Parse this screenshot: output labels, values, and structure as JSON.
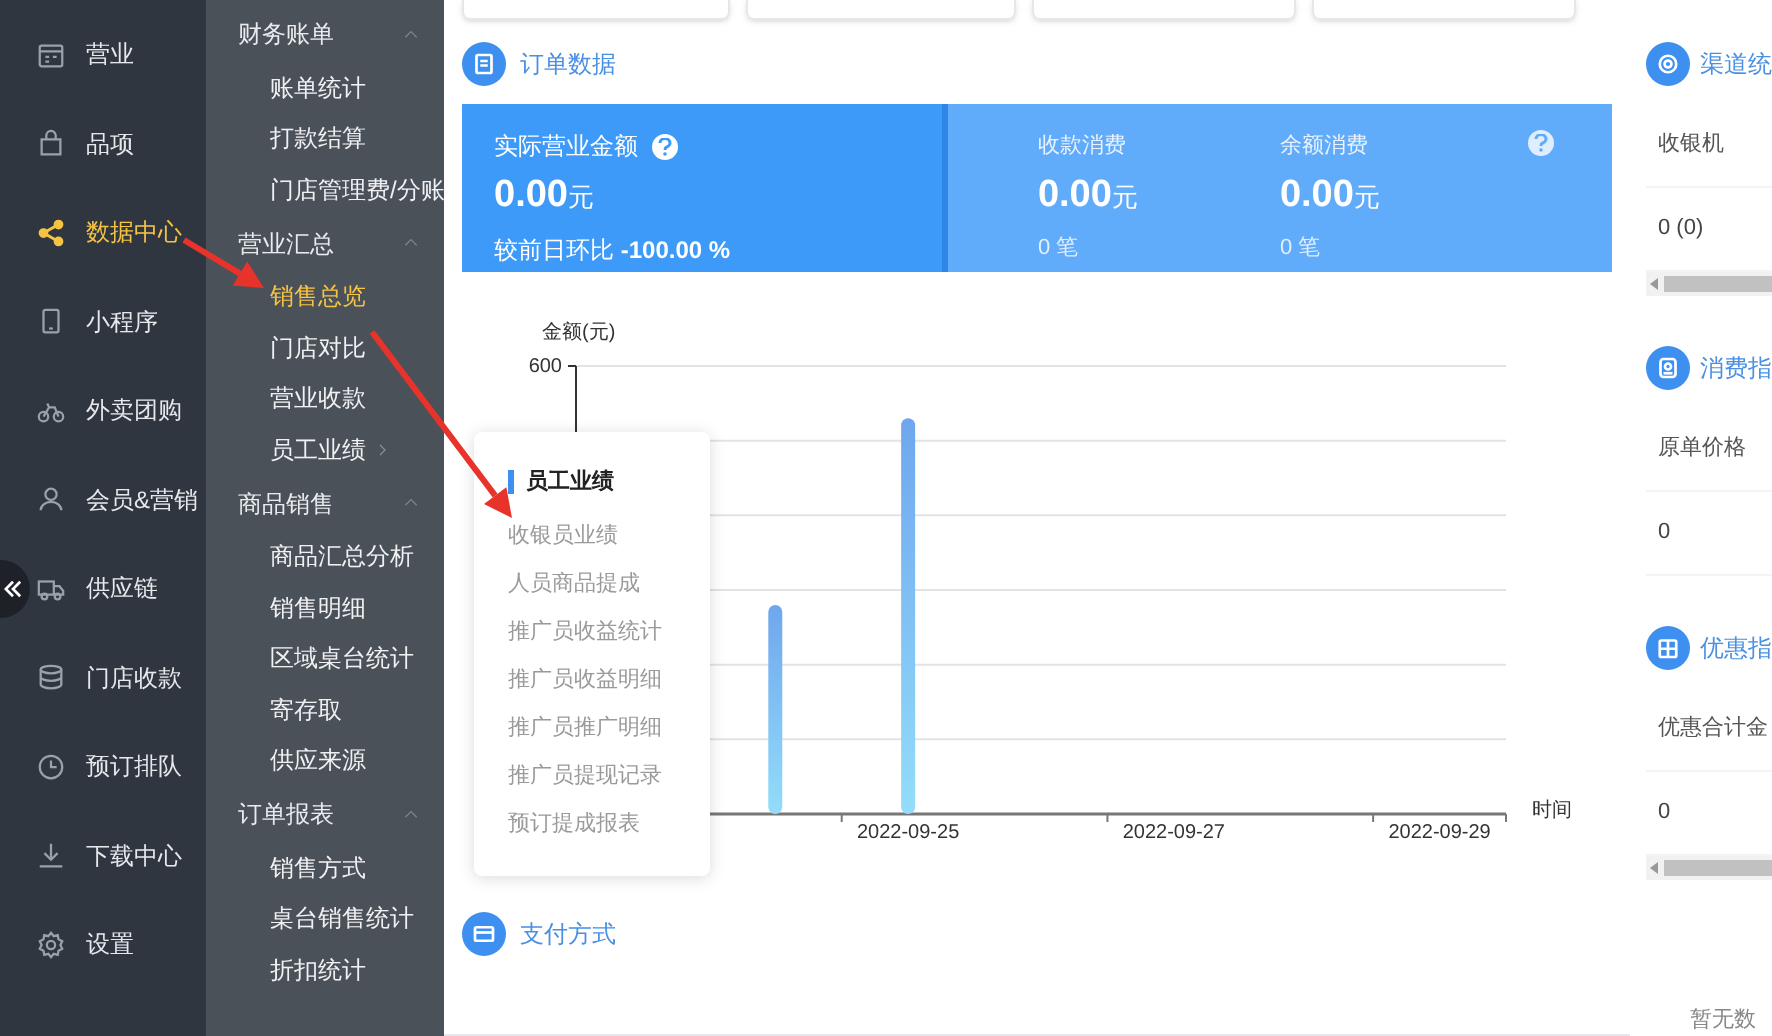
{
  "sidebar": {
    "items": [
      {
        "label": "营业",
        "selected": false
      },
      {
        "label": "品项",
        "selected": false
      },
      {
        "label": "数据中心",
        "selected": true
      },
      {
        "label": "小程序",
        "selected": false
      },
      {
        "label": "外卖团购",
        "selected": false
      },
      {
        "label": "会员&营销",
        "selected": false
      },
      {
        "label": "供应链",
        "selected": false
      },
      {
        "label": "门店收款",
        "selected": false
      },
      {
        "label": "预订排队",
        "selected": false
      },
      {
        "label": "下载中心",
        "selected": false
      },
      {
        "label": "设置",
        "selected": false
      }
    ]
  },
  "submenu": {
    "groups": [
      {
        "title": "财务账单",
        "expanded": true,
        "items": [
          {
            "label": "账单统计",
            "selected": false,
            "has_children": false
          },
          {
            "label": "打款结算",
            "selected": false,
            "has_children": false
          },
          {
            "label": "门店管理费/分账",
            "selected": false,
            "has_children": false
          }
        ]
      },
      {
        "title": "营业汇总",
        "expanded": true,
        "items": [
          {
            "label": "销售总览",
            "selected": true,
            "has_children": false
          },
          {
            "label": "门店对比",
            "selected": false,
            "has_children": false
          },
          {
            "label": "营业收款",
            "selected": false,
            "has_children": false
          },
          {
            "label": "员工业绩",
            "selected": false,
            "has_children": true
          }
        ]
      },
      {
        "title": "商品销售",
        "expanded": true,
        "items": [
          {
            "label": "商品汇总分析",
            "selected": false,
            "has_children": false
          },
          {
            "label": "销售明细",
            "selected": false,
            "has_children": false
          },
          {
            "label": "区域桌台统计",
            "selected": false,
            "has_children": false
          },
          {
            "label": "寄存取",
            "selected": false,
            "has_children": false
          },
          {
            "label": "供应来源",
            "selected": false,
            "has_children": false
          }
        ]
      },
      {
        "title": "订单报表",
        "expanded": true,
        "items": [
          {
            "label": "销售方式",
            "selected": false,
            "has_children": false
          },
          {
            "label": "桌台销售统计",
            "selected": false,
            "has_children": false
          },
          {
            "label": "折扣统计",
            "selected": false,
            "has_children": false
          }
        ]
      }
    ]
  },
  "order_data": {
    "title": "订单数据",
    "primary": {
      "label": "实际营业金额",
      "help": true,
      "value": "0.00",
      "unit": "元",
      "note": "较前日环比 **-100.00 %**"
    },
    "secondary": {
      "help": true,
      "metrics": [
        {
          "label": "收款消费",
          "value": "0.00",
          "unit": "元",
          "note": "0 笔"
        },
        {
          "label": "余额消费",
          "value": "0.00",
          "unit": "元",
          "note": "0 笔"
        }
      ]
    }
  },
  "chart_data": {
    "type": "bar",
    "ylabel": "金额(元)",
    "xlabel": "时间",
    "categories": [
      null,
      null,
      "2022-09-25",
      null,
      "2022-09-27",
      null,
      "2022-09-29"
    ],
    "values": [
      0,
      280,
      530,
      0,
      0,
      0,
      0
    ],
    "ylim": [
      0,
      600
    ],
    "yticks": [
      600
    ]
  },
  "popup": {
    "title": "员工业绩",
    "items": [
      {
        "label": "收银员业绩"
      },
      {
        "label": "人员商品提成"
      },
      {
        "label": "推广员收益统计"
      },
      {
        "label": "推广员收益明细"
      },
      {
        "label": "推广员推广明细"
      },
      {
        "label": "推广员提现记录"
      },
      {
        "label": "预订提成报表"
      }
    ]
  },
  "payment": {
    "title": "支付方式"
  },
  "right_panels": [
    {
      "title": "渠道统",
      "kind": "scrolling",
      "columns": [
        "收银机"
      ],
      "rows": [
        [
          "0 (0)"
        ]
      ]
    },
    {
      "title": "消费指",
      "kind": "plain",
      "columns": [
        "原单价格"
      ],
      "rows": [
        [
          "0"
        ]
      ]
    },
    {
      "title": "优惠指",
      "kind": "scrolling",
      "columns": [
        "优惠合计金"
      ],
      "rows": [
        [
          "0"
        ]
      ]
    }
  ],
  "empty_text": "暂无数",
  "annotations": [
    {
      "kind": "arrow"
    },
    {
      "kind": "arrow"
    }
  ]
}
